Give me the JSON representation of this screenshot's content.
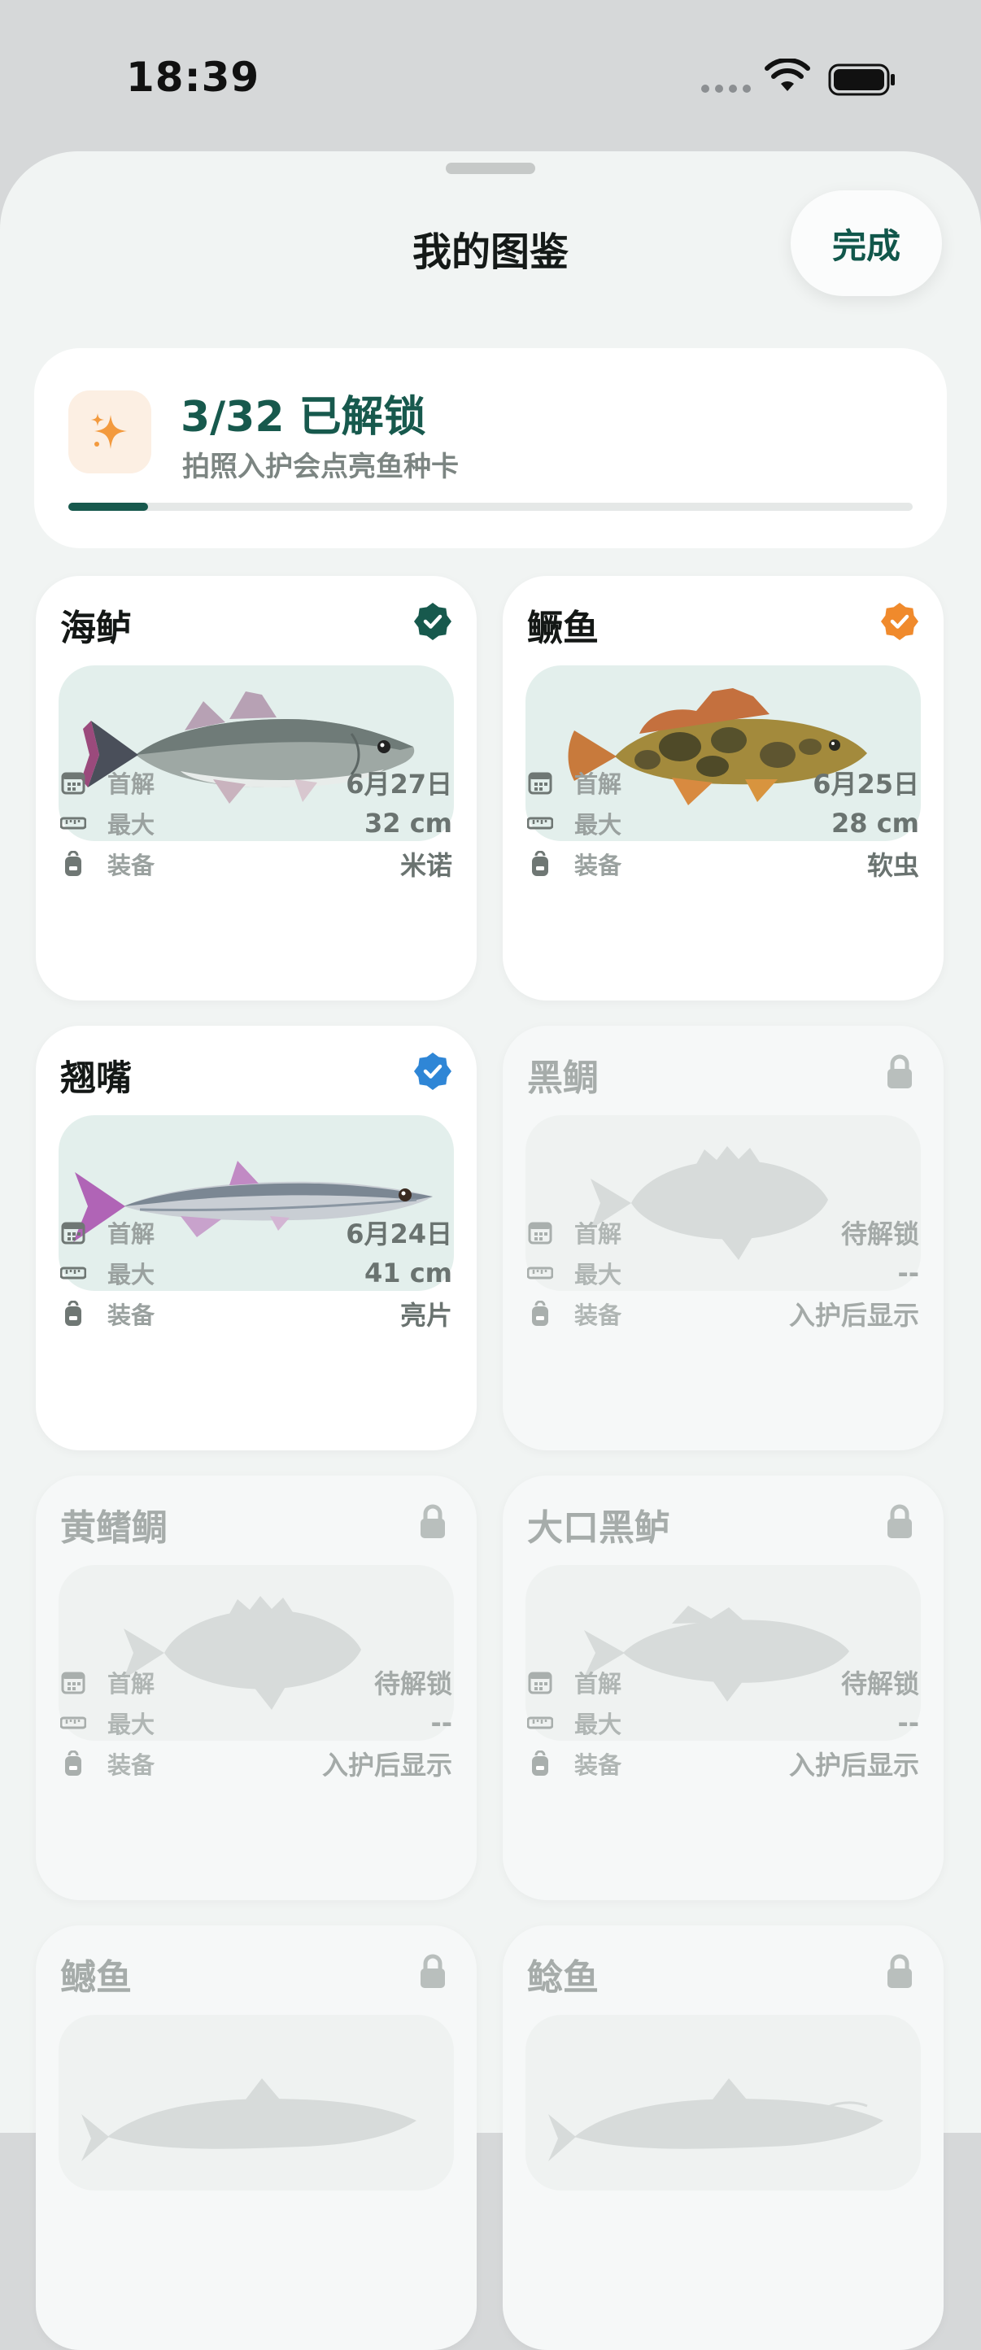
{
  "status_bar": {
    "time": "18:39"
  },
  "sheet": {
    "title": "我的图鉴",
    "done_label": "完成"
  },
  "summary": {
    "count_text": "3/32 已解锁",
    "subtitle": "拍照入护会点亮鱼种卡",
    "progress_fraction": 0.094,
    "icon": "sparkles-icon"
  },
  "info_labels": {
    "first": "首解",
    "max": "最大",
    "gear": "装备"
  },
  "colors": {
    "accent": "#17594d",
    "badge_green": "#17594d",
    "badge_orange": "#f08a2c",
    "badge_blue": "#2f86d6",
    "lock_gray": "#b9bfbd"
  },
  "cards": [
    {
      "name": "海鲈",
      "status": "unlocked",
      "badge": "green-check-badge-icon",
      "fish": "sea-bass",
      "first": "6月27日",
      "max": "32 cm",
      "gear": "米诺"
    },
    {
      "name": "鳜鱼",
      "status": "unlocked",
      "badge": "orange-check-badge-icon",
      "fish": "mandarin-fish",
      "first": "6月25日",
      "max": "28 cm",
      "gear": "软虫"
    },
    {
      "name": "翘嘴",
      "status": "unlocked",
      "badge": "blue-check-badge-icon",
      "fish": "topmouth-culter",
      "first": "6月24日",
      "max": "41 cm",
      "gear": "亮片"
    },
    {
      "name": "黑鲷",
      "status": "locked",
      "badge": "lock-icon",
      "fish": "black-seabream-silhouette",
      "first": "待解锁",
      "max": "--",
      "gear": "入护后显示"
    },
    {
      "name": "黄鳍鲷",
      "status": "locked",
      "badge": "lock-icon",
      "fish": "yellowfin-seabream-silhouette",
      "first": "待解锁",
      "max": "--",
      "gear": "入护后显示"
    },
    {
      "name": "大口黑鲈",
      "status": "locked",
      "badge": "lock-icon",
      "fish": "largemouth-bass-silhouette",
      "first": "待解锁",
      "max": "--",
      "gear": "入护后显示"
    },
    {
      "name": "鳡鱼",
      "status": "locked",
      "badge": "lock-icon",
      "fish": "yellowcheek-silhouette"
    },
    {
      "name": "鲶鱼",
      "status": "locked",
      "badge": "lock-icon",
      "fish": "catfish-silhouette"
    }
  ]
}
